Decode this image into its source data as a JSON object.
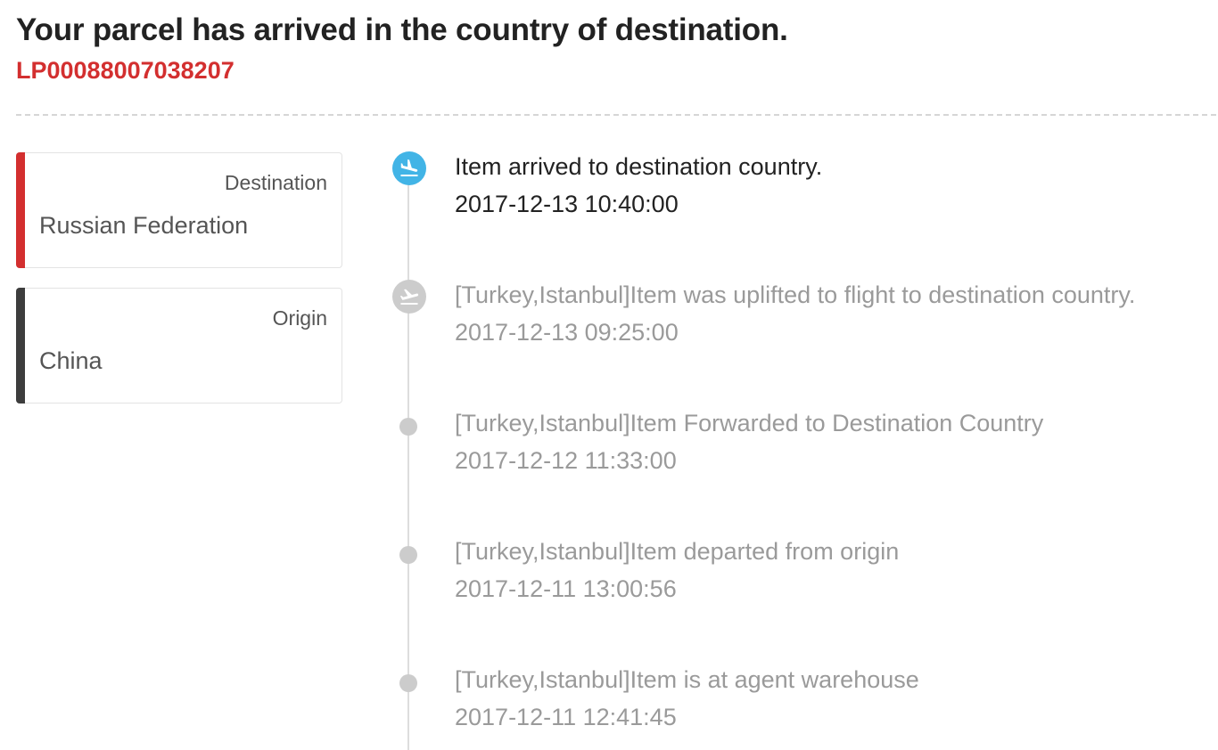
{
  "header": {
    "title": "Your parcel has arrived in the country of destination.",
    "tracking_number": "LP00088007038207"
  },
  "colors": {
    "accent_red": "#d32f2f",
    "accent_dark": "#3d3d3d",
    "active_icon": "#42b4e6",
    "inactive_icon": "#cccccc",
    "inactive_text": "#9a9a9a"
  },
  "cards": {
    "destination": {
      "label": "Destination",
      "value": "Russian Federation"
    },
    "origin": {
      "label": "Origin",
      "value": "China"
    }
  },
  "timeline": [
    {
      "description": "Item arrived to destination country.",
      "time": "2017-12-13 10:40:00",
      "state": "active",
      "icon": "plane-landing-icon"
    },
    {
      "description": "[Turkey,Istanbul]Item was uplifted to flight to destination country.",
      "time": "2017-12-13 09:25:00",
      "state": "past",
      "icon": "plane-takeoff-icon"
    },
    {
      "description": "[Turkey,Istanbul]Item Forwarded to Destination Country",
      "time": "2017-12-12 11:33:00",
      "state": "past",
      "icon": "dot-icon"
    },
    {
      "description": "[Turkey,Istanbul]Item departed from origin",
      "time": "2017-12-11 13:00:56",
      "state": "past",
      "icon": "dot-icon"
    },
    {
      "description": "[Turkey,Istanbul]Item is at agent warehouse",
      "time": "2017-12-11 12:41:45",
      "state": "past",
      "icon": "dot-icon"
    }
  ]
}
